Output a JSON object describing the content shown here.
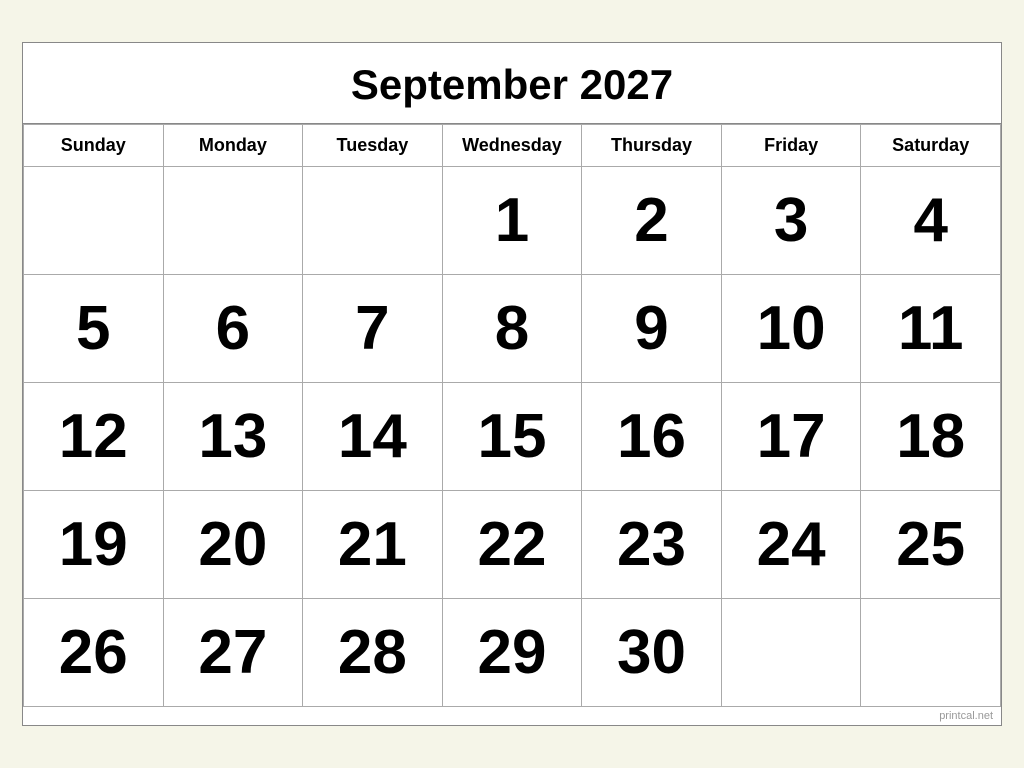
{
  "calendar": {
    "title": "September 2027",
    "days_of_week": [
      "Sunday",
      "Monday",
      "Tuesday",
      "Wednesday",
      "Thursday",
      "Friday",
      "Saturday"
    ],
    "weeks": [
      [
        null,
        null,
        null,
        "1",
        "2",
        "3",
        "4"
      ],
      [
        "5",
        "6",
        "7",
        "8",
        "9",
        "10",
        "11"
      ],
      [
        "12",
        "13",
        "14",
        "15",
        "16",
        "17",
        "18"
      ],
      [
        "19",
        "20",
        "21",
        "22",
        "23",
        "24",
        "25"
      ],
      [
        "26",
        "27",
        "28",
        "29",
        "30",
        null,
        null
      ]
    ],
    "watermark": "printcal.net"
  }
}
